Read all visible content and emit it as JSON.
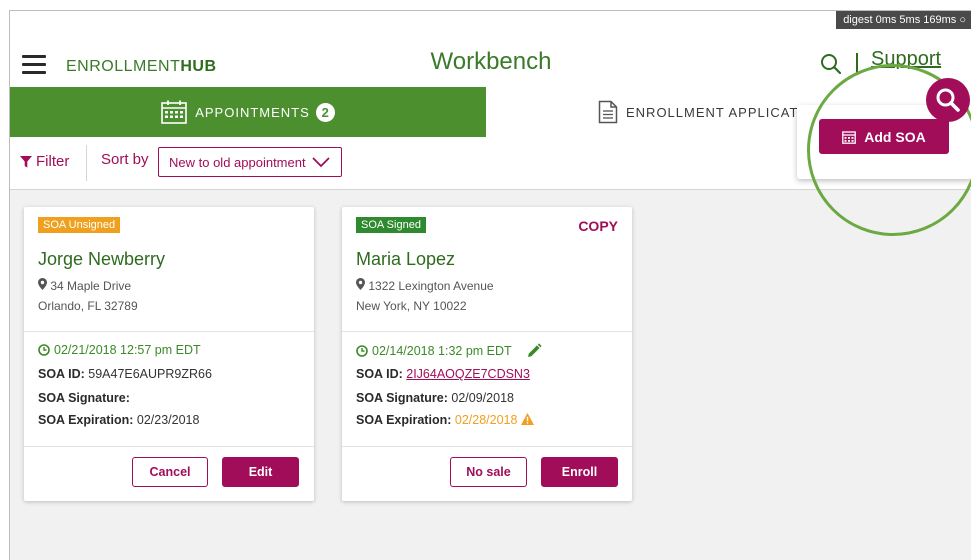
{
  "debug": {
    "digest": "digest 0ms 5ms 169ms ○"
  },
  "header": {
    "logo_prefix": "ENROLLMENT",
    "logo_bold": "HUB",
    "title": "Workbench",
    "support": "Support"
  },
  "tabs": {
    "appointments": {
      "label": "APPOINTMENTS",
      "count": "2"
    },
    "enrollment": {
      "label": "ENROLLMENT APPLICATION"
    }
  },
  "filterbar": {
    "filter_label": "Filter",
    "sort_label": "Sort by",
    "sort_value": "New to old appointment"
  },
  "cards": [
    {
      "status": "SOA Unsigned",
      "name": "Jorge Newberry",
      "address_line1": "34 Maple Drive",
      "address_line2": "Orlando, FL 32789",
      "appointment_time": "02/21/2018 12:57 pm EDT",
      "soa_id_label": "SOA ID:",
      "soa_id": "59A47E6AUPR9ZR66",
      "signature_label": "SOA Signature:",
      "signature": "",
      "expiration_label": "SOA Expiration:",
      "expiration": "02/23/2018",
      "btn_left": "Cancel",
      "btn_right": "Edit"
    },
    {
      "status": "SOA Signed",
      "copy": "COPY",
      "name": "Maria Lopez",
      "address_line1": "1322 Lexington Avenue",
      "address_line2": "New York, NY 10022",
      "appointment_time": "02/14/2018 1:32 pm EDT",
      "soa_id_label": "SOA ID:",
      "soa_id": "2IJ64AOQZE7CDSN3",
      "signature_label": "SOA Signature:",
      "signature": "02/09/2018",
      "expiration_label": "SOA Expiration:",
      "expiration": "02/28/2018",
      "btn_left": "No sale",
      "btn_right": "Enroll"
    }
  ],
  "popover": {
    "add_soa": "Add SOA"
  },
  "colors": {
    "brand_green": "#4b8f2f",
    "dark_green": "#2e6b1f",
    "accent_magenta": "#a10d59",
    "warning_orange": "#f0a01f",
    "highlight_ring": "#6da943"
  }
}
